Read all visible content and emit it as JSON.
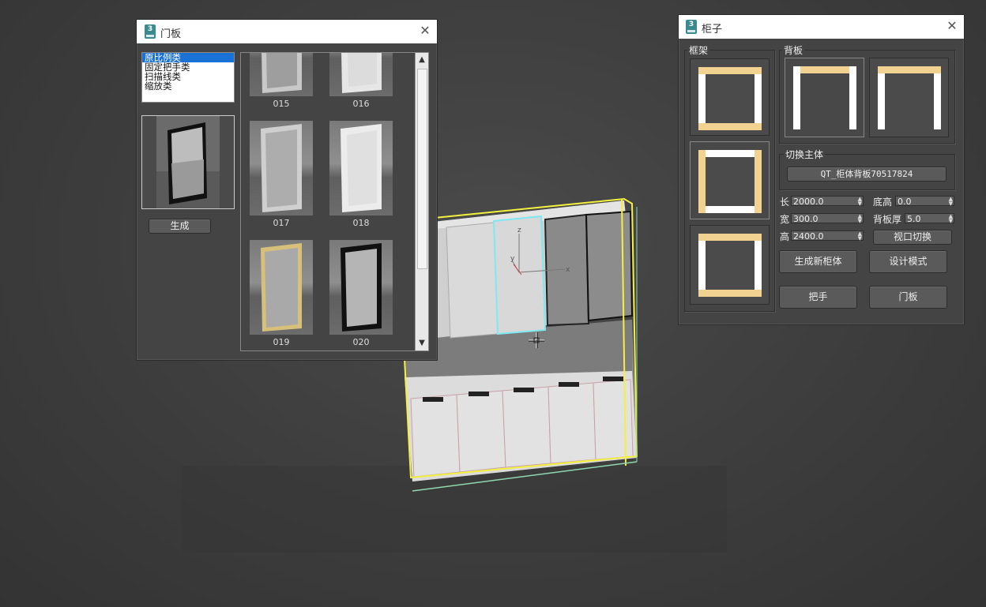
{
  "door_dialog": {
    "title": "门板",
    "categories": [
      "原比例类",
      "固定把手类",
      "扫描线类",
      "缩放类"
    ],
    "selected_category": "原比例类",
    "generate_label": "生成",
    "thumbnails": [
      {
        "label": "015"
      },
      {
        "label": "016"
      },
      {
        "label": "017"
      },
      {
        "label": "018"
      },
      {
        "label": "019"
      },
      {
        "label": "020"
      }
    ]
  },
  "cabinet_dialog": {
    "title": "柜子",
    "frame_label": "框架",
    "backboard_label": "背板",
    "switch_body_label": "切换主体",
    "switch_body_value": "QT_柜体背板70517824",
    "fields": {
      "length_label": "长",
      "length_value": "2000.0",
      "width_label": "宽",
      "width_value": "300.0",
      "height_label": "高",
      "height_value": "2400.0",
      "base_height_label": "底高",
      "base_height_value": "0.0",
      "back_thickness_label": "背板厚",
      "back_thickness_value": "5.0"
    },
    "viewport_switch_label": "视口切换",
    "new_cabinet_label": "生成新柜体",
    "design_mode_label": "设计模式",
    "handle_label": "把手",
    "door_label": "门板"
  },
  "colors": {
    "accent_frame": "#f2d291",
    "panel_bg": "#444444",
    "selection_blue": "#1a72d6",
    "highlight_cyan": "#7fe8f0",
    "bbox_yellow": "#f3f040"
  },
  "icons": [
    "app-3dsmax-icon",
    "close-icon",
    "scroll-up-icon",
    "scroll-down-icon",
    "crosshair-cursor-icon"
  ]
}
